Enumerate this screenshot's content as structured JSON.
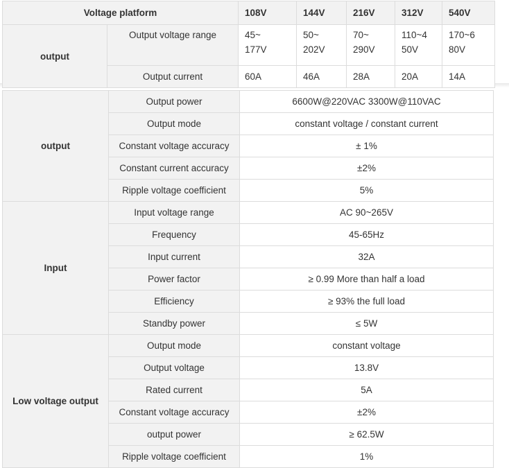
{
  "table1": {
    "header": {
      "label": "Voltage platform",
      "voltages": [
        "108V",
        "144V",
        "216V",
        "312V",
        "540V"
      ]
    },
    "group": "output",
    "rows": [
      {
        "label": "Output voltage range",
        "values": [
          [
            "45~",
            "177V"
          ],
          [
            "50~",
            "202V"
          ],
          [
            "70~",
            "290V"
          ],
          [
            "110~4",
            "50V"
          ],
          [
            "170~6",
            "80V"
          ]
        ]
      },
      {
        "label": "Output current",
        "values": [
          "60A",
          "46A",
          "28A",
          "20A",
          "14A"
        ]
      }
    ]
  },
  "table2": {
    "groups": [
      {
        "name": "output",
        "rows": [
          {
            "label": "Output power",
            "value": "6600W@220VAC 3300W@110VAC"
          },
          {
            "label": "Output mode",
            "value": "constant voltage / constant current"
          },
          {
            "label": "Constant voltage accuracy",
            "value": "± 1%"
          },
          {
            "label": "Constant current accuracy",
            "value": "±2%"
          },
          {
            "label": "Ripple voltage coefficient",
            "value": "5%"
          }
        ]
      },
      {
        "name": "Input",
        "rows": [
          {
            "label": "Input voltage range",
            "value": "AC 90~265V"
          },
          {
            "label": "Frequency",
            "value": "45-65Hz"
          },
          {
            "label": "Input current",
            "value": "32A"
          },
          {
            "label": "Power factor",
            "value": "≥ 0.99 More than half a load"
          },
          {
            "label": "Efficiency",
            "value": "≥ 93% the full load"
          },
          {
            "label": "Standby power",
            "value": "≤ 5W"
          }
        ]
      },
      {
        "name": "Low voltage output",
        "rows": [
          {
            "label": "Output mode",
            "value": "constant voltage"
          },
          {
            "label": "Output voltage",
            "value": "13.8V"
          },
          {
            "label": "Rated current",
            "value": "5A"
          },
          {
            "label": "Constant voltage accuracy",
            "value": "±2%"
          },
          {
            "label": "output power",
            "value": "≥ 62.5W"
          },
          {
            "label": "Ripple voltage coefficient",
            "value": "1%"
          }
        ]
      }
    ]
  }
}
